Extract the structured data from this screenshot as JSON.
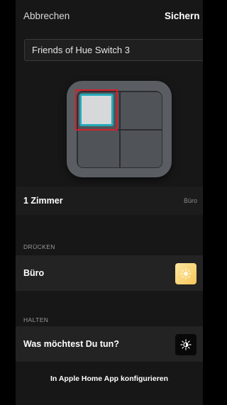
{
  "header": {
    "cancel_label": "Abbrechen",
    "save_label": "Sichern"
  },
  "device_name": {
    "value": "Friends of Hue Switch 3"
  },
  "rooms": {
    "label": "1 Zimmer",
    "value": "Büro"
  },
  "press": {
    "section_label": "DRÜCKEN",
    "item_label": "Büro",
    "icon": "sun-icon"
  },
  "hold": {
    "section_label": "HALTEN",
    "item_label": "Was möchtest Du tun?",
    "icon": "brightness-icon"
  },
  "homekit": {
    "label": "In Apple Home App konfigurieren"
  },
  "colors": {
    "background": "#171717",
    "row": "#232323",
    "selection_border": "#d71f2b",
    "selected_button_outline": "#26a9b8",
    "scene_tile": "#f6c65a"
  }
}
